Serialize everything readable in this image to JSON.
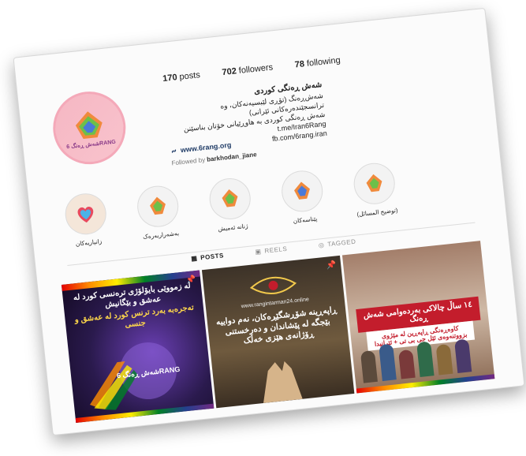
{
  "profile": {
    "stats": {
      "posts_count": "170",
      "posts_label": "posts",
      "followers_count": "702",
      "followers_label": "followers",
      "following_count": "78",
      "following_label": "following"
    },
    "name": "شەش ڕەنگی کوردی",
    "bio_lines": [
      "شەش‌ڕەنگ (تۆڕی لێبسیەنەکان، وە ترانسجێندەرەکانی ئێرانی)",
      "شەش ڕەنگی کوردی بە هاوڕێیانی خۆتان بناسێنن",
      "t.me/Iran6Rang",
      "fb.com/6rang.iran"
    ],
    "website": "www.6rang.org",
    "followed_by_prefix": "Followed by",
    "followed_by_user": "barkhodan_jiane",
    "avatar_text": "شەش ڕەنگ 6RANG"
  },
  "highlights": [
    {
      "label": "(توضیح المسائل)"
    },
    {
      "label": "پێناسەکان"
    },
    {
      "label": "ژنانە ئەمیش"
    },
    {
      "label": "بەشەراربەرەک"
    },
    {
      "label": "زانیاریەکان"
    }
  ],
  "tabs": [
    {
      "label": "POSTS",
      "active": true
    },
    {
      "label": "REELS",
      "active": false
    },
    {
      "label": "TAGGED",
      "active": false
    }
  ],
  "posts": [
    {
      "headline": "لە زمووێی بایۆلۆژی ترەنسی کورد لە عەشق و بێگانیش",
      "subline": "تەجرەبە بەرد ترنس کورد لە عەشق و جنسی",
      "logo": "شەش ڕەنگ 6RANG"
    },
    {
      "site": "www.rangintarman24.online",
      "headline": "ڕاپەڕینە شۆڕشگێڕەکان، نەم دواییە بێجگە لە پێشاندان و دەرخستنی ڕۆژانەی هێزی خەڵک"
    },
    {
      "headline": "١٤ ساڵ چالاکی بەردەوامی شەش ڕەنگ",
      "subline": "کاوەڕەنگی ڕاپەڕین لە مێژوی بزووتنەوەی ئێل جی بی تی + ئێرانیدا"
    }
  ],
  "colors": {
    "accent_link": "#1f3b66",
    "badge_red": "#c31d2c",
    "avatar_pink": "#f6b7c3"
  }
}
